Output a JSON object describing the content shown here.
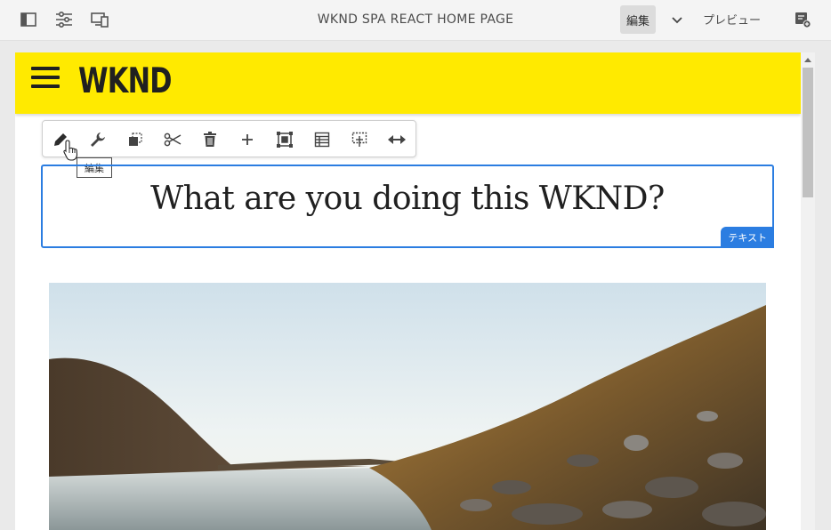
{
  "topbar": {
    "title": "WKND SPA REACT HOME PAGE",
    "edit_label": "編集",
    "preview_label": "プレビュー"
  },
  "site": {
    "logo": "WKND"
  },
  "component_toolbar": {
    "tooltip": "編集",
    "actions": [
      "edit",
      "configure",
      "copy",
      "cut",
      "delete",
      "insert",
      "parent",
      "layout",
      "group",
      "layout-mode"
    ]
  },
  "text_component": {
    "heading": "What are you doing this WKND?",
    "label": "テキスト"
  },
  "colors": {
    "brand_yellow": "#ffea00",
    "selection_blue": "#2b7de1",
    "toolbar_bg": "#f4f4f4"
  }
}
